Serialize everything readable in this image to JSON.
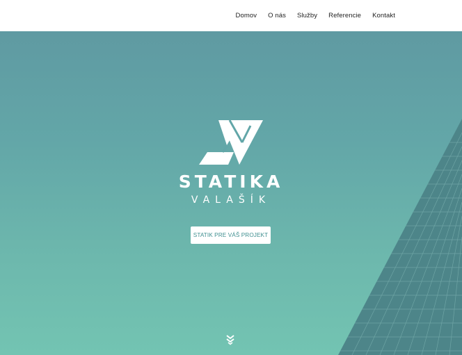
{
  "nav": {
    "items": [
      {
        "label": "Domov"
      },
      {
        "label": "O nás"
      },
      {
        "label": "Služby"
      },
      {
        "label": "Referencie"
      },
      {
        "label": "Kontakt"
      }
    ]
  },
  "hero": {
    "brand": "STATIKA",
    "brand_sub": "VALAŠÍK",
    "cta_label": "STATIK PRE VÁŠ PROJEKT",
    "scroll_icon": "double-chevron-down-icon"
  },
  "colors": {
    "hero_top": "#5f9aa2",
    "hero_bottom": "#73c4b2",
    "building": "#4a7f85",
    "cta_text": "#3f8f90"
  }
}
